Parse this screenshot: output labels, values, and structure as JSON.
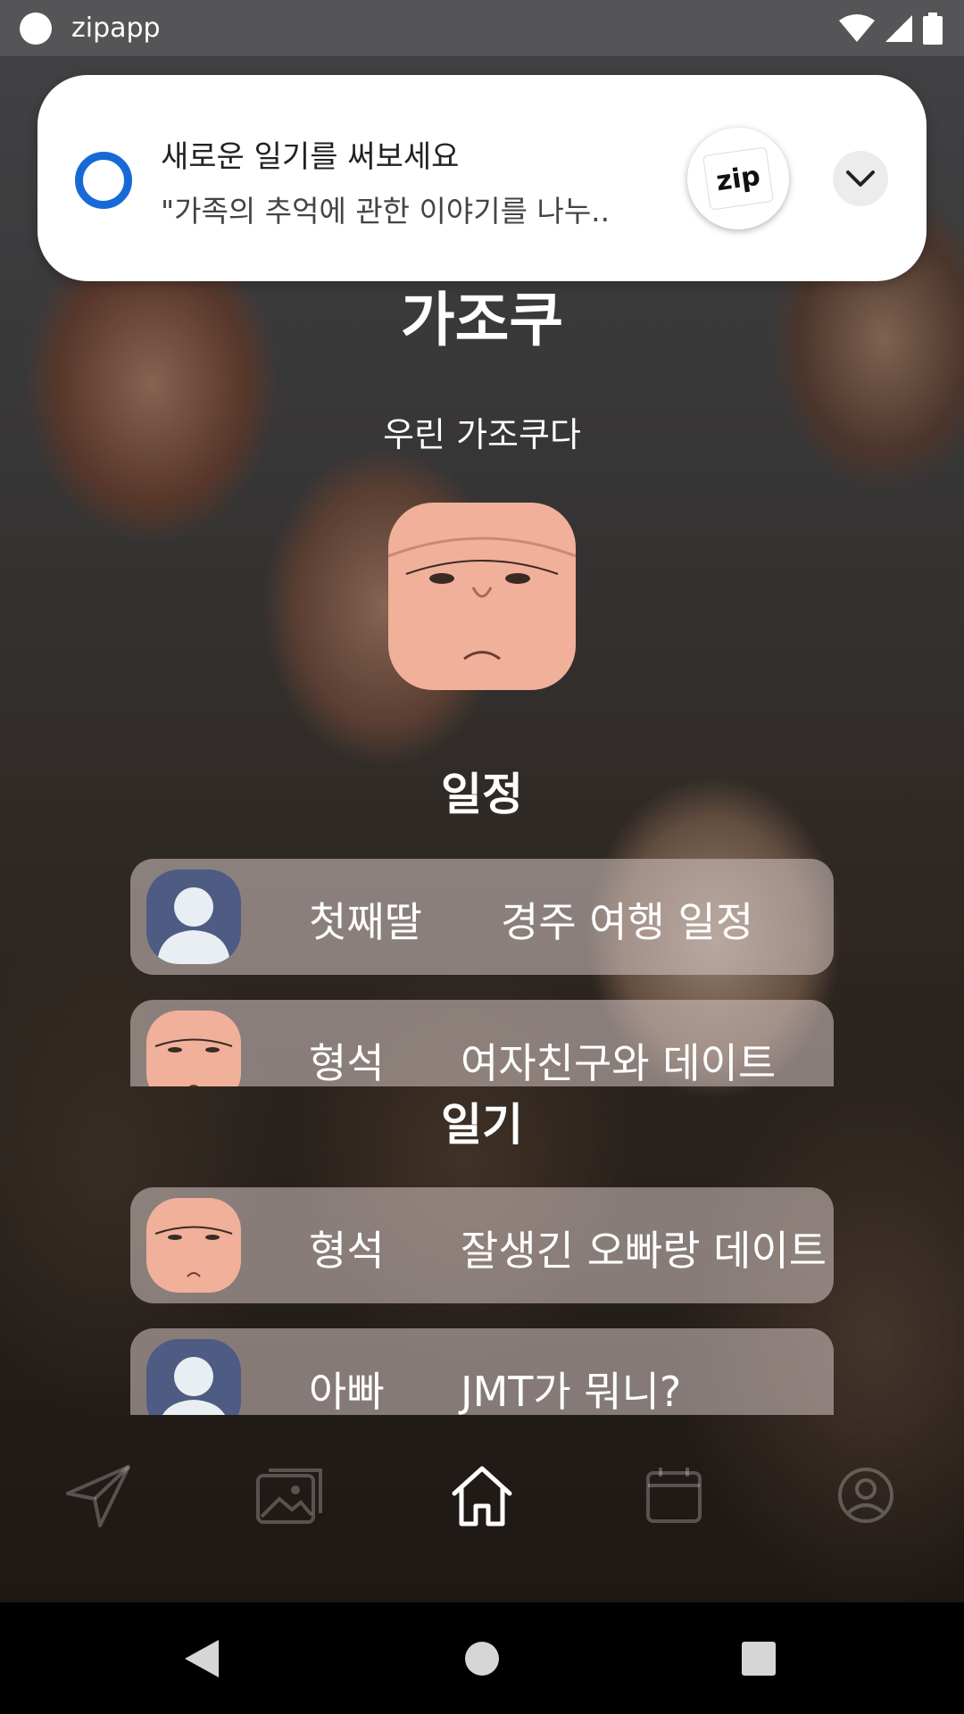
{
  "status_bar": {
    "app_name": "zipapp"
  },
  "notification": {
    "title": "새로운 일기를 써보세요",
    "body": "\"가족의 추억에 관한 이야기를 나누..",
    "app_icon_label": "zip"
  },
  "group": {
    "name": "가조쿠",
    "subtitle": "우린 가조쿠다"
  },
  "schedule": {
    "title": "일정",
    "items": [
      {
        "author": "첫째딸",
        "text": "경주 여행 일정",
        "avatar": "default-person"
      },
      {
        "author": "형석",
        "text": "여자친구와 데이트",
        "avatar": "face-cartoon"
      }
    ]
  },
  "diary": {
    "title": "일기",
    "items": [
      {
        "author": "형석",
        "text": "잘생긴 오빠랑 데이트",
        "avatar": "face-cartoon"
      },
      {
        "author": "아빠",
        "text": "JMT가 뭐니?",
        "avatar": "default-person"
      }
    ]
  },
  "bottom_nav": {
    "items": [
      "send-icon",
      "gallery-icon",
      "home-icon",
      "calendar-icon",
      "profile-icon"
    ],
    "active": "home-icon"
  },
  "colors": {
    "notification_accent": "#1769d8",
    "card_bg": "#d7c8c6"
  }
}
